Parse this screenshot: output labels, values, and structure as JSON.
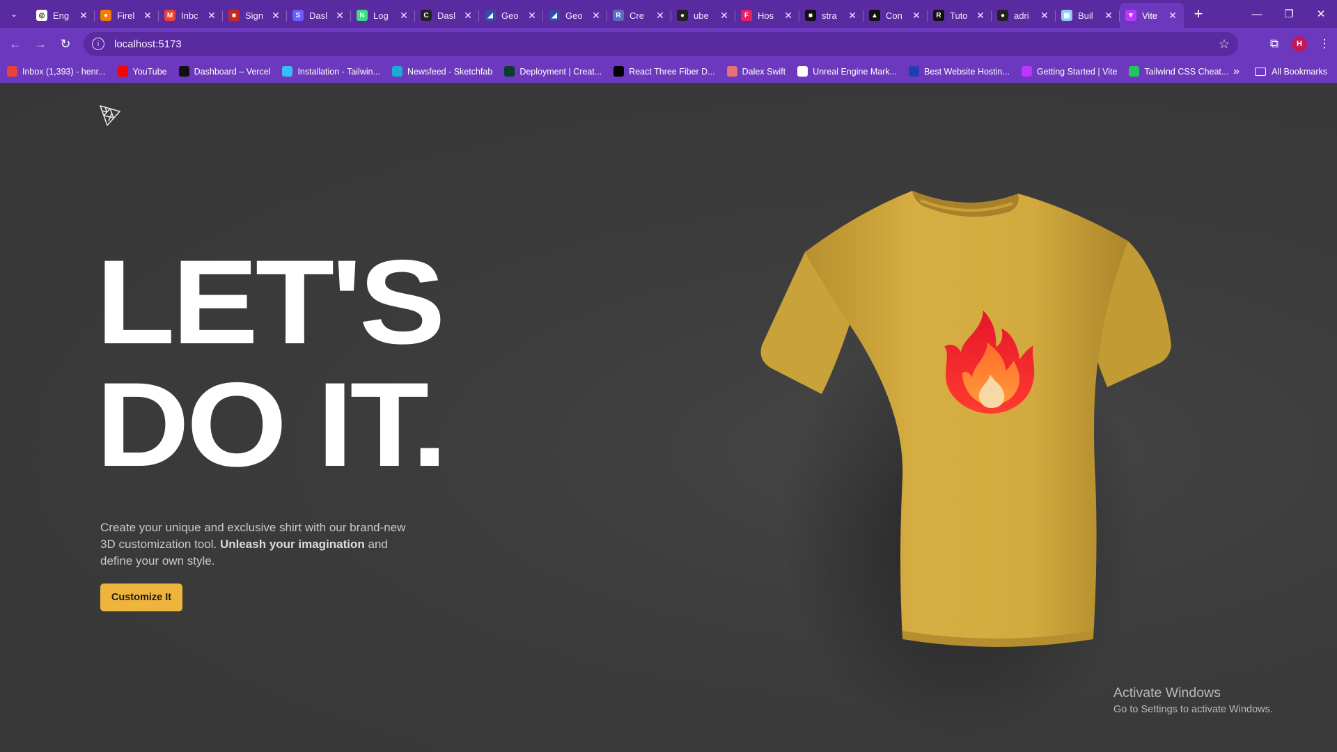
{
  "browser": {
    "tabs": [
      {
        "title": "Eng",
        "fav_color": "#ffffff",
        "fav_text": "◎"
      },
      {
        "title": "Firel",
        "fav_color": "#f57c00",
        "fav_text": "●"
      },
      {
        "title": "Inbc",
        "fav_color": "#ea4335",
        "fav_text": "M"
      },
      {
        "title": "Sign",
        "fav_color": "#c62828",
        "fav_text": "■"
      },
      {
        "title": "Dasl",
        "fav_color": "#6a5cff",
        "fav_text": "S"
      },
      {
        "title": "Log",
        "fav_color": "#3ddc84",
        "fav_text": "N"
      },
      {
        "title": "Dasl",
        "fav_color": "#222222",
        "fav_text": "C"
      },
      {
        "title": "Geo",
        "fav_color": "#3949ab",
        "fav_text": "◢"
      },
      {
        "title": "Geo",
        "fav_color": "#3949ab",
        "fav_text": "◢"
      },
      {
        "title": "Cre",
        "fav_color": "#5c6bc0",
        "fav_text": "R"
      },
      {
        "title": "ube",
        "fav_color": "#222222",
        "fav_text": "●"
      },
      {
        "title": "Hos",
        "fav_color": "#e91e63",
        "fav_text": "F"
      },
      {
        "title": "stra",
        "fav_color": "#111111",
        "fav_text": "■"
      },
      {
        "title": "Con",
        "fav_color": "#111111",
        "fav_text": "▲"
      },
      {
        "title": "Tuto",
        "fav_color": "#111111",
        "fav_text": "R"
      },
      {
        "title": "adri",
        "fav_color": "#222222",
        "fav_text": "●"
      },
      {
        "title": "Buil",
        "fav_color": "#90caf9",
        "fav_text": "▣"
      },
      {
        "title": "Vite",
        "fav_color": "#bd34fe",
        "fav_text": "▼",
        "active": true
      }
    ],
    "url": "localhost:5173",
    "profile_initial": "H",
    "bookmarks": [
      {
        "label": "Inbox (1,393) - henr...",
        "color": "#ea4335"
      },
      {
        "label": "YouTube",
        "color": "#ff0000"
      },
      {
        "label": "Dashboard – Vercel",
        "color": "#111111"
      },
      {
        "label": "Installation - Tailwin...",
        "color": "#38bdf8"
      },
      {
        "label": "Newsfeed - Sketchfab",
        "color": "#1caad9"
      },
      {
        "label": "Deployment | Creat...",
        "color": "#0b3d2e"
      },
      {
        "label": "React Three Fiber D...",
        "color": "#000000"
      },
      {
        "label": "Dalex Swift",
        "color": "#e57373"
      },
      {
        "label": "Unreal Engine Mark...",
        "color": "#ffffff"
      },
      {
        "label": "Best Website Hostin...",
        "color": "#1e40af"
      },
      {
        "label": "Getting Started | Vite",
        "color": "#bd34fe"
      },
      {
        "label": "Tailwind CSS Cheat...",
        "color": "#22c55e"
      }
    ],
    "all_bookmarks_label": "All Bookmarks"
  },
  "hero": {
    "headline_line1": "LET'S",
    "headline_line2": "DO IT.",
    "desc_part1": "Create your unique and exclusive shirt with our brand-new 3D customization tool. ",
    "desc_bold": "Unleash your imagination",
    "desc_part2": " and define your own style.",
    "cta_label": "Customize It"
  },
  "shirt": {
    "color": "#d4ad3e",
    "decal": "flame-logo"
  },
  "os_watermark": {
    "title": "Activate Windows",
    "subtitle": "Go to Settings to activate Windows."
  }
}
